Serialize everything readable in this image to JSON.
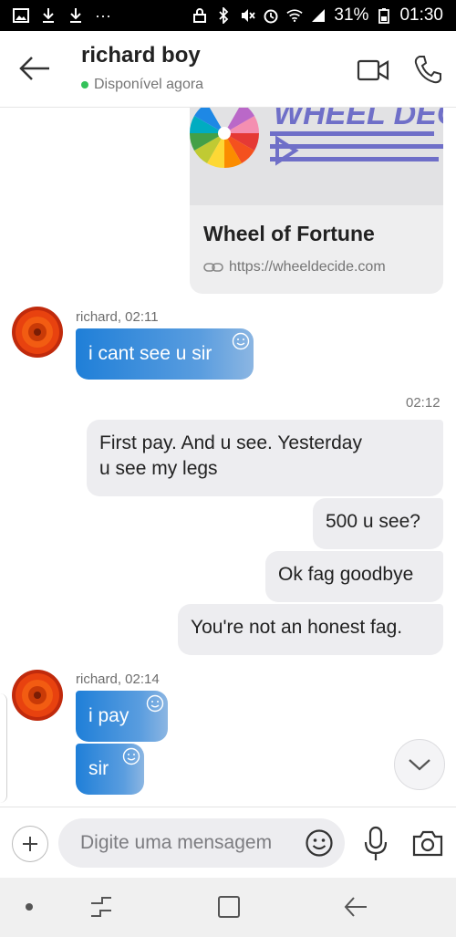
{
  "status_bar": {
    "battery": "31%",
    "time": "01:30",
    "more": "···"
  },
  "header": {
    "contact_name": "richard boy",
    "presence": "Disponível agora"
  },
  "link_card": {
    "title": "Wheel of Fortune",
    "url": "https://wheeldecide.com",
    "logo_text": "WHEEL DECIDE"
  },
  "messages": [
    {
      "sender": "richard, 02:11",
      "text": "i cant see u sir"
    },
    {
      "time": "02:12"
    },
    {
      "text_line1": "First pay. And u see. Yesterday",
      "text_line2": "u see my legs"
    },
    {
      "text": "500 u see?"
    },
    {
      "text": "Ok fag goodbye"
    },
    {
      "text": "You're not an honest fag."
    },
    {
      "sender": "richard, 02:14",
      "text": "i pay"
    },
    {
      "text": "sir"
    }
  ],
  "compose": {
    "placeholder": "Digite uma mensagem"
  },
  "colors": {
    "accent": "#1f7fd8",
    "online": "#34c25a",
    "bubble_out": "#ededf0"
  }
}
